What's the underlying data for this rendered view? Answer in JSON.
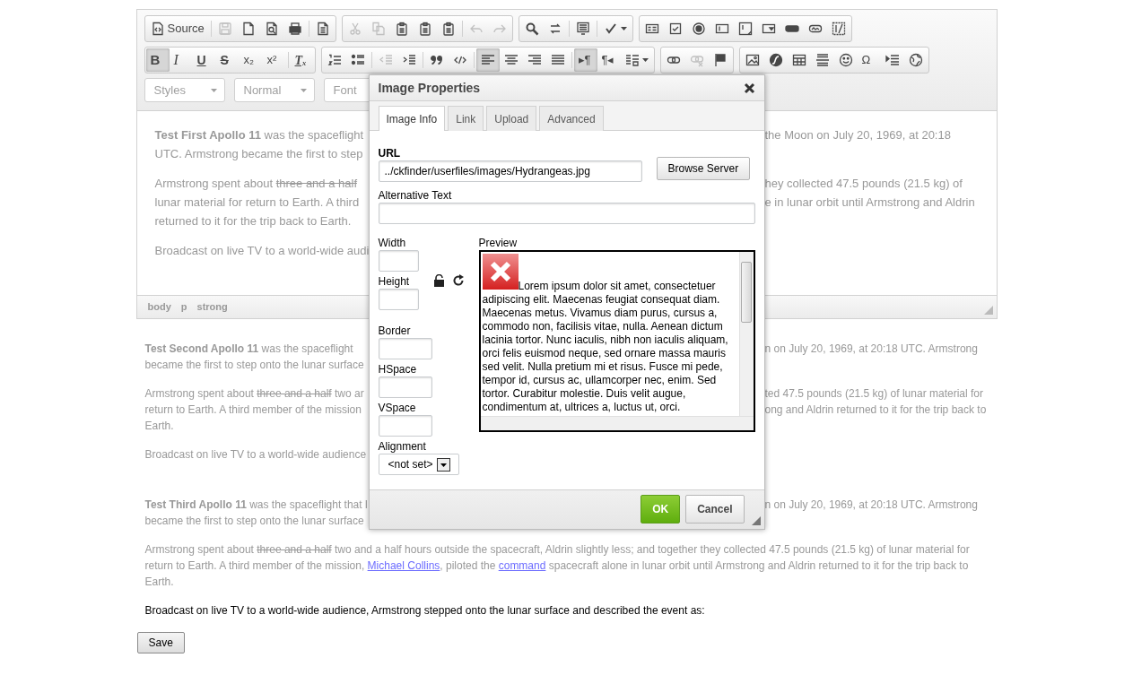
{
  "toolbar": {
    "rows": [
      {
        "groups": [
          {
            "sections": [
              {
                "items": [
                  {
                    "label": "Source",
                    "selected": false,
                    "disabled": false
                  }
                ]
              },
              {
                "items": [
                  {
                    "selected": false,
                    "disabled": true
                  },
                  {
                    "selected": false,
                    "disabled": false
                  },
                  {
                    "selected": false,
                    "disabled": false
                  },
                  {
                    "selected": false,
                    "disabled": false
                  }
                ]
              },
              {
                "items": [
                  {
                    "selected": false,
                    "disabled": false
                  }
                ]
              }
            ]
          },
          {
            "sections": [
              {
                "items": [
                  {
                    "selected": false,
                    "disabled": true
                  },
                  {
                    "selected": false,
                    "disabled": true
                  },
                  {
                    "selected": false,
                    "disabled": false
                  },
                  {
                    "selected": false,
                    "disabled": false
                  },
                  {
                    "selected": false,
                    "disabled": false
                  }
                ]
              },
              {
                "items": [
                  {
                    "selected": false,
                    "disabled": true
                  },
                  {
                    "selected": false,
                    "disabled": true
                  }
                ]
              }
            ]
          },
          {
            "sections": [
              {
                "items": [
                  {
                    "selected": false,
                    "disabled": false
                  },
                  {
                    "selected": false,
                    "disabled": false
                  }
                ]
              },
              {
                "items": [
                  {
                    "selected": false,
                    "disabled": false
                  }
                ]
              },
              {
                "items": [
                  {
                    "selected": false,
                    "disabled": false
                  }
                ]
              }
            ]
          },
          {
            "sections": [
              {
                "items": [
                  {
                    "selected": false,
                    "disabled": false
                  },
                  {
                    "selected": false,
                    "disabled": false
                  },
                  {
                    "selected": false,
                    "disabled": false
                  },
                  {
                    "selected": false,
                    "disabled": false
                  },
                  {
                    "selected": false,
                    "disabled": false
                  },
                  {
                    "selected": false,
                    "disabled": false
                  },
                  {
                    "selected": false,
                    "disabled": false
                  },
                  {
                    "selected": false,
                    "disabled": false
                  },
                  {
                    "selected": false,
                    "disabled": false
                  }
                ]
              }
            ]
          }
        ]
      },
      {
        "groups": [
          {
            "sections": [
              {
                "items": [
                  {
                    "label": "B",
                    "selected": true,
                    "disabled": false
                  },
                  {
                    "label": "I",
                    "selected": false,
                    "disabled": false
                  },
                  {
                    "label": "U",
                    "selected": false,
                    "disabled": false
                  },
                  {
                    "label": "S",
                    "selected": false,
                    "disabled": false
                  },
                  {
                    "label": "x₂",
                    "selected": false,
                    "disabled": false
                  },
                  {
                    "label": "x²",
                    "selected": false,
                    "disabled": false
                  }
                ]
              },
              {
                "items": [
                  {
                    "label": "Tₓ",
                    "selected": false,
                    "disabled": false
                  }
                ]
              }
            ]
          },
          {
            "sections": [
              {
                "items": [
                  {
                    "selected": false,
                    "disabled": false
                  },
                  {
                    "selected": false,
                    "disabled": false
                  }
                ]
              },
              {
                "items": [
                  {
                    "selected": false,
                    "disabled": true
                  },
                  {
                    "selected": false,
                    "disabled": false
                  }
                ]
              },
              {
                "items": [
                  {
                    "selected": false,
                    "disabled": false
                  },
                  {
                    "selected": false,
                    "disabled": false
                  }
                ]
              },
              {
                "items": [
                  {
                    "selected": true,
                    "disabled": false
                  },
                  {
                    "selected": false,
                    "disabled": false
                  },
                  {
                    "selected": false,
                    "disabled": false
                  },
                  {
                    "selected": false,
                    "disabled": false
                  }
                ]
              },
              {
                "items": [
                  {
                    "label": "▸¶",
                    "selected": true,
                    "disabled": false
                  },
                  {
                    "label": "¶◂",
                    "selected": false,
                    "disabled": false
                  },
                  {
                    "selected": false,
                    "disabled": false
                  }
                ]
              }
            ]
          },
          {
            "sections": [
              {
                "items": [
                  {
                    "selected": false,
                    "disabled": false
                  },
                  {
                    "selected": false,
                    "disabled": true
                  },
                  {
                    "selected": false,
                    "disabled": false
                  }
                ]
              }
            ]
          },
          {
            "sections": [
              {
                "items": [
                  {
                    "selected": false,
                    "disabled": false
                  },
                  {
                    "selected": false,
                    "disabled": false
                  },
                  {
                    "selected": false,
                    "disabled": false
                  },
                  {
                    "selected": false,
                    "disabled": false
                  },
                  {
                    "selected": false,
                    "disabled": false
                  },
                  {
                    "label": "Ω",
                    "selected": false,
                    "disabled": false
                  },
                  {
                    "selected": false,
                    "disabled": false
                  },
                  {
                    "selected": false,
                    "disabled": false
                  }
                ]
              }
            ]
          }
        ]
      }
    ],
    "combos": [
      {
        "label": "Styles"
      },
      {
        "label": "Normal"
      },
      {
        "label": "Font"
      }
    ]
  },
  "editor": {
    "paragraphs": [
      {
        "lines": [
          {
            "left": [
              {
                "text": "Test First Apollo 11",
                "kind": "bold"
              },
              {
                "text": " was the spaceflight",
                "kind": "plain"
              }
            ],
            "right": [
              {
                "text": "the Moon on July 20, 1969, at 20:18",
                "kind": "plain"
              }
            ]
          },
          {
            "left": [
              {
                "text": "UTC. Armstrong became the first to step",
                "kind": "plain"
              }
            ]
          }
        ]
      },
      {
        "lines": [
          {
            "left": [
              {
                "text": "Armstrong spent about ",
                "kind": "plain"
              },
              {
                "text": "three and a half",
                "kind": "strike"
              }
            ],
            "right": [
              {
                "text": "hey collected 47.5 pounds (21.5 kg) of",
                "kind": "plain"
              }
            ]
          },
          {
            "left": [
              {
                "text": "lunar material for return to Earth. A third",
                "kind": "plain"
              }
            ],
            "right": [
              {
                "text": "e in lunar orbit until Armstrong and Aldrin",
                "kind": "plain"
              }
            ]
          },
          {
            "left": [
              {
                "text": "returned to it for the trip back to Earth.",
                "kind": "plain"
              }
            ]
          }
        ]
      },
      {
        "lines": [
          {
            "left": [
              {
                "text": "Broadcast on live TV to a world-wide audi",
                "kind": "plain"
              }
            ]
          }
        ]
      }
    ],
    "path": [
      "body",
      "p",
      "strong"
    ]
  },
  "articles": [
    {
      "paragraphs": [
        {
          "kind": "muted",
          "lines": [
            {
              "left": [
                {
                  "text": "Test Second Apollo 11",
                  "kind": "bold"
                },
                {
                  "text": " was the spaceflight",
                  "kind": "plain"
                }
              ],
              "right": [
                {
                  "text": "n on July 20, 1969, at 20:18 UTC. Armstrong",
                  "kind": "plain"
                }
              ]
            },
            {
              "left": [
                {
                  "text": "became the first to step onto the lunar surface",
                  "kind": "plain"
                }
              ]
            }
          ]
        },
        {
          "kind": "muted",
          "lines": [
            {
              "left": [
                {
                  "text": "Armstrong spent about ",
                  "kind": "plain"
                },
                {
                  "text": "three and a half",
                  "kind": "strike"
                },
                {
                  "text": " two ar",
                  "kind": "plain"
                }
              ],
              "right": [
                {
                  "text": "ted 47.5 pounds (21.5 kg) of lunar material for",
                  "kind": "plain"
                }
              ]
            },
            {
              "left": [
                {
                  "text": "return to Earth. A third member of the mission",
                  "kind": "plain"
                }
              ],
              "right": [
                {
                  "text": "ong and Aldrin returned to it for the trip back to",
                  "kind": "plain"
                }
              ]
            },
            {
              "left": [
                {
                  "text": "Earth.",
                  "kind": "plain"
                }
              ]
            }
          ]
        },
        {
          "kind": "muted",
          "lines": [
            {
              "left": [
                {
                  "text": "Broadcast on live TV to a world-wide audience",
                  "kind": "plain"
                }
              ]
            }
          ]
        }
      ]
    },
    {
      "paragraphs": [
        {
          "kind": "muted",
          "lines": [
            {
              "left": [
                {
                  "text": "Test Third Apollo 11",
                  "kind": "bold"
                },
                {
                  "text": " was the spaceflight that l",
                  "kind": "plain"
                }
              ],
              "right": [
                {
                  "text": "n on July 20, 1969, at 20:18 UTC. Armstrong",
                  "kind": "plain"
                }
              ]
            },
            {
              "left": [
                {
                  "text": "became the first to step onto the lunar surface",
                  "kind": "plain"
                }
              ]
            }
          ]
        },
        {
          "kind": "muted",
          "segments": [
            {
              "text": "Armstrong spent about ",
              "kind": "plain"
            },
            {
              "text": "three and a half",
              "kind": "strike"
            },
            {
              "text": " two and a half hours outside the spacecraft, Aldrin slightly less; and together they collected 47.5 pounds (21.5 kg) of lunar material for return to Earth. A third member of the mission, ",
              "kind": "plain"
            },
            {
              "text": "Michael Collins",
              "kind": "link"
            },
            {
              "text": ", piloted the ",
              "kind": "plain"
            },
            {
              "text": "command",
              "kind": "link"
            },
            {
              "text": " spacecraft alone in lunar orbit until Armstrong and Aldrin returned to it for the trip back to Earth.",
              "kind": "plain"
            }
          ]
        },
        {
          "kind": "normal",
          "segments": [
            {
              "text": "Broadcast on live TV to a world-wide audience, Armstrong stepped onto the lunar surface and described the event as:",
              "kind": "plain"
            }
          ]
        }
      ]
    }
  ],
  "save_button": "Save",
  "dialog": {
    "title": "Image Properties",
    "tabs": [
      {
        "label": "Image Info",
        "selected": true
      },
      {
        "label": "Link",
        "selected": false
      },
      {
        "label": "Upload",
        "selected": false
      },
      {
        "label": "Advanced",
        "selected": false
      }
    ],
    "url": {
      "label": "URL",
      "value": "../ckfinder/userfiles/images/Hydrangeas.jpg"
    },
    "browse_button": "Browse Server",
    "alt_text": {
      "label": "Alternative Text"
    },
    "width": {
      "label": "Width"
    },
    "height": {
      "label": "Height"
    },
    "border": {
      "label": "Border"
    },
    "hspace": {
      "label": "HSpace"
    },
    "vspace": {
      "label": "VSpace"
    },
    "alignment": {
      "label": "Alignment",
      "value": "<not set>"
    },
    "preview": {
      "label": "Preview",
      "text": "Lorem ipsum dolor sit amet, consectetuer adipiscing elit. Maecenas feugiat consequat diam. Maecenas metus. Vivamus diam purus, cursus a, commodo non, facilisis vitae, nulla. Aenean dictum lacinia tortor. Nunc iaculis, nibh non iaculis aliquam, orci felis euismod neque, sed ornare massa mauris sed velit. Nulla pretium mi et risus. Fusce mi pede, tempor id, cursus ac, ullamcorper nec, enim. Sed tortor. Curabitur molestie. Duis velit augue, condimentum at, ultrices a, luctus ut, orci."
    },
    "ok_button": "OK",
    "cancel_button": "Cancel"
  }
}
